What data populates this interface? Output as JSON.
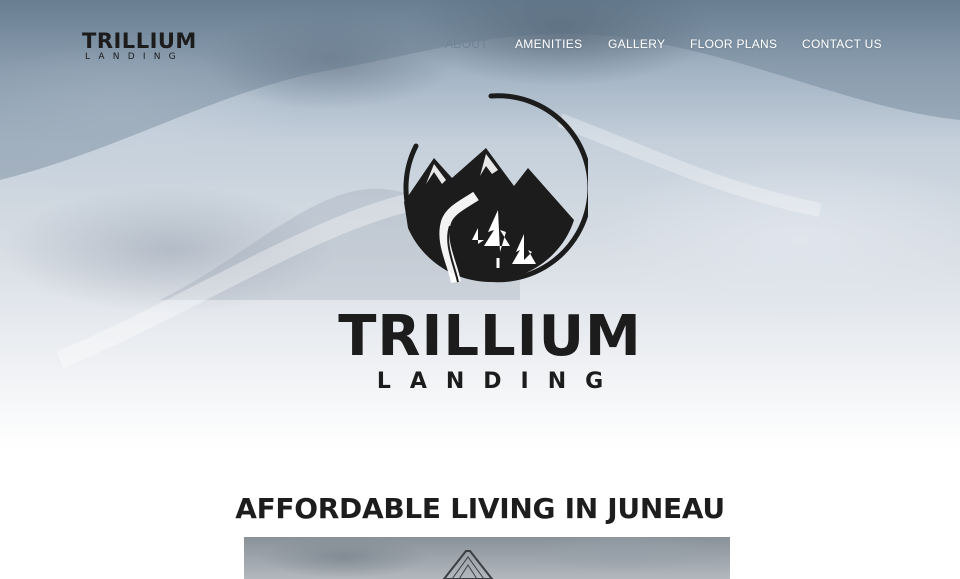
{
  "brand": {
    "name": "TRILLIUM",
    "tagline": "LANDING"
  },
  "nav": {
    "items": [
      {
        "label": "ABOUT",
        "active": true
      },
      {
        "label": "AMENITIES",
        "active": false
      },
      {
        "label": "GALLERY",
        "active": false
      },
      {
        "label": "FLOOR PLANS",
        "active": false
      },
      {
        "label": "CONTACT US",
        "active": false
      }
    ]
  },
  "hero": {
    "title": "TRILLIUM",
    "subtitle": "LANDING",
    "icon": "mountain-river-trees-emblem-icon"
  },
  "intro": {
    "heading": "AFFORDABLE LIVING IN JUNEAU"
  },
  "colors": {
    "active_nav": "#6e8496",
    "nav_text": "#ffffff",
    "logo": "#1c1c1c"
  }
}
